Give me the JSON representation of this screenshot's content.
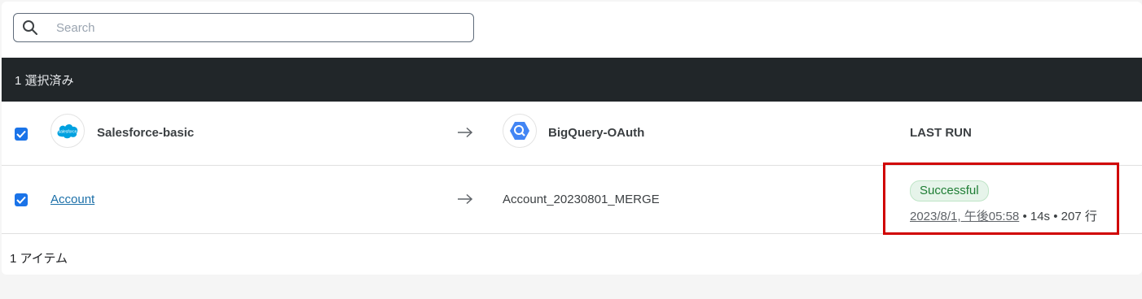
{
  "search": {
    "placeholder": "Search",
    "icon": "search-icon"
  },
  "selection_bar": {
    "label": "1 選択済み"
  },
  "connection_row": {
    "source": {
      "name": "Salesforce-basic",
      "logo_text": "salesforce",
      "logo_color": "#00a1e0"
    },
    "destination": {
      "name": "BigQuery-OAuth",
      "logo_color": "#4285f4"
    },
    "last_run_header": "LAST RUN",
    "checked": true
  },
  "data_row": {
    "source_object": "Account",
    "destination_table": "Account_20230801_MERGE",
    "checked": true,
    "status": "Successful",
    "timestamp": "2023/8/1, 午後05:58",
    "separator": "•",
    "duration": "14s",
    "rows": "207 行"
  },
  "footer": {
    "item_count": "1 アイテム"
  },
  "colors": {
    "accent": "#1a73e8",
    "dark_bar": "#212629",
    "success_bg": "#e6f4ea",
    "success_text": "#1e7d34",
    "highlight": "#d00000"
  }
}
